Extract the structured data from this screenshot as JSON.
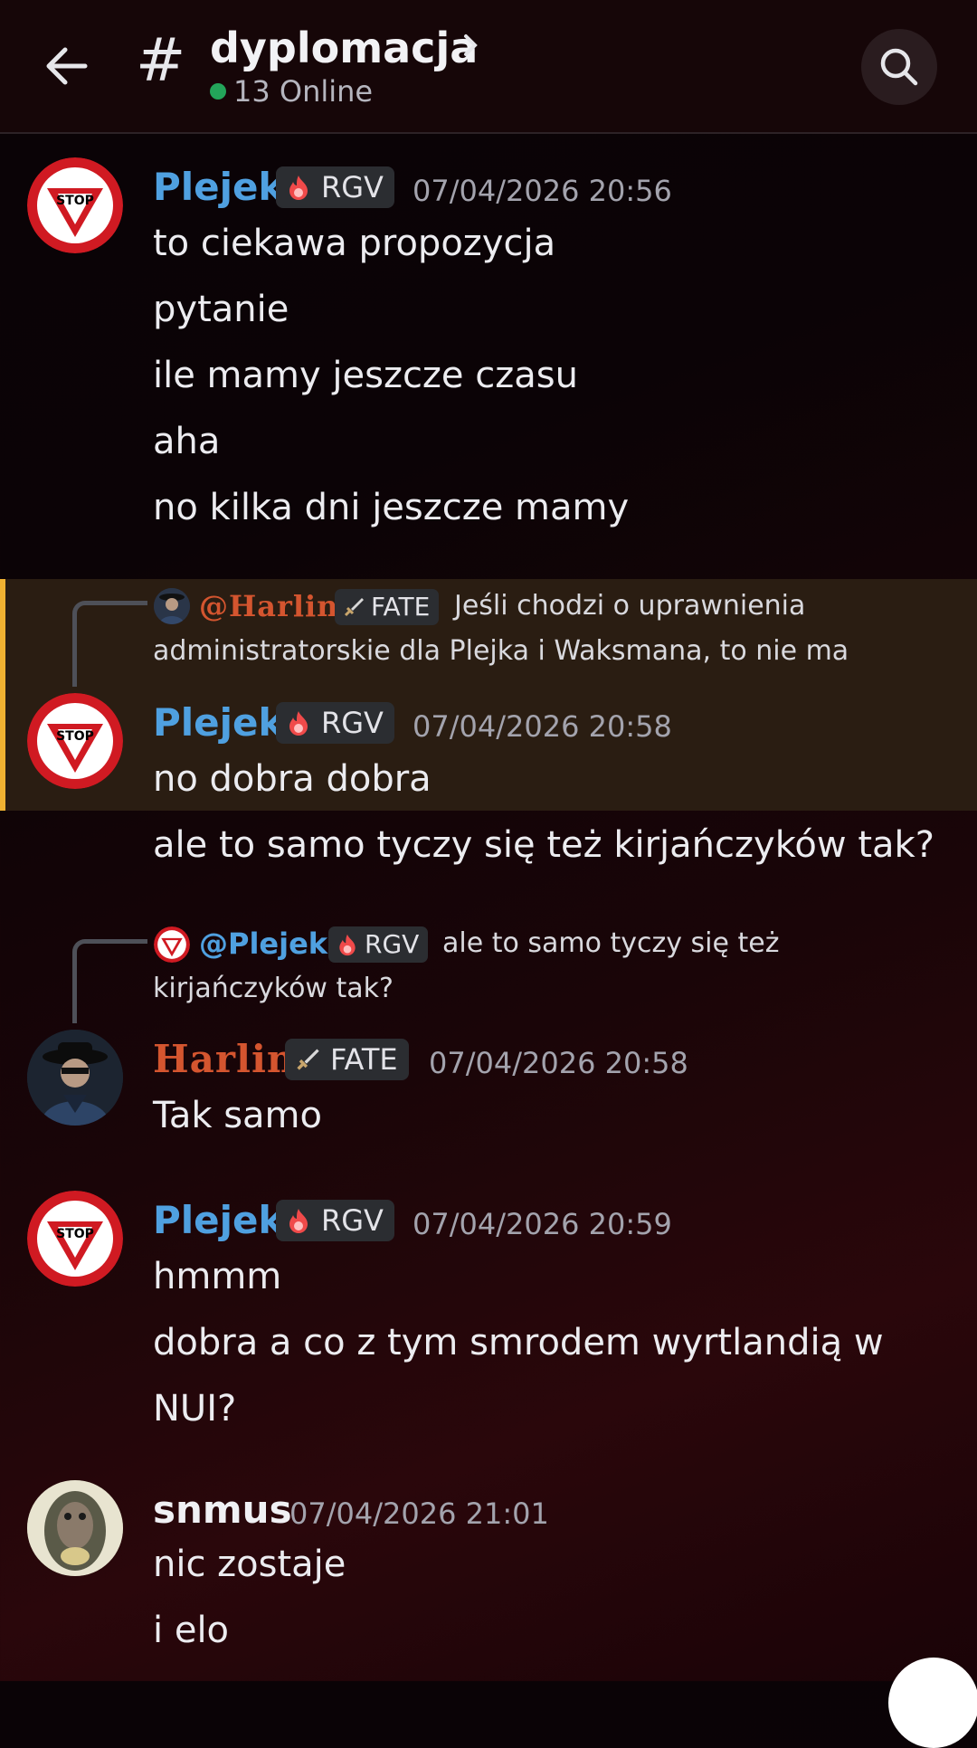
{
  "header": {
    "channel": "dyplomacja",
    "online": "13 Online"
  },
  "colors": {
    "plejek": "#4fa0e0",
    "harlin": "#d4552f",
    "snmus": "#f0f0f4",
    "online_dot": "#23a55a",
    "highlight": "#f0b232"
  },
  "messages": [
    {
      "author": "Plejek",
      "tag": "RGV",
      "time": "07/04/2026 20:56",
      "lines": [
        "to ciekawa propozycja",
        "pytanie",
        "ile mamy jeszcze czasu",
        "aha",
        "no kilka dni jeszcze mamy"
      ]
    },
    {
      "reply": {
        "author": "@Harlin",
        "tag": "FATE",
        "text1": "Jeśli chodzi o uprawnienia",
        "text2": "administratorskie dla Plejka i Waksmana, to nie ma"
      },
      "author": "Plejek",
      "tag": "RGV",
      "time": "07/04/2026 20:58",
      "lines": [
        "no dobra dobra",
        "ale to samo tyczy się też kirjańczyków tak?"
      ]
    },
    {
      "reply": {
        "author": "@Plejek",
        "tag": "RGV",
        "text1": "ale to samo tyczy się też",
        "text2": "kirjańczyków tak?"
      },
      "author": "Harlin",
      "tag": "FATE",
      "time": "07/04/2026 20:58",
      "lines": [
        "Tak samo"
      ]
    },
    {
      "author": "Plejek",
      "tag": "RGV",
      "time": "07/04/2026 20:59",
      "lines": [
        "hmmm",
        "dobra a co z tym smrodem wyrtlandią w",
        "NUI?"
      ]
    },
    {
      "author": "snmus",
      "time": "07/04/2026 21:01",
      "lines": [
        "nic zostaje",
        "i elo"
      ]
    }
  ],
  "icons": {
    "back": "arrow-left-icon",
    "hash": "hash-icon",
    "search": "search-icon",
    "stop": "stop-sign-avatar",
    "rgv": "flame-icon",
    "fate": "sword-icon"
  }
}
